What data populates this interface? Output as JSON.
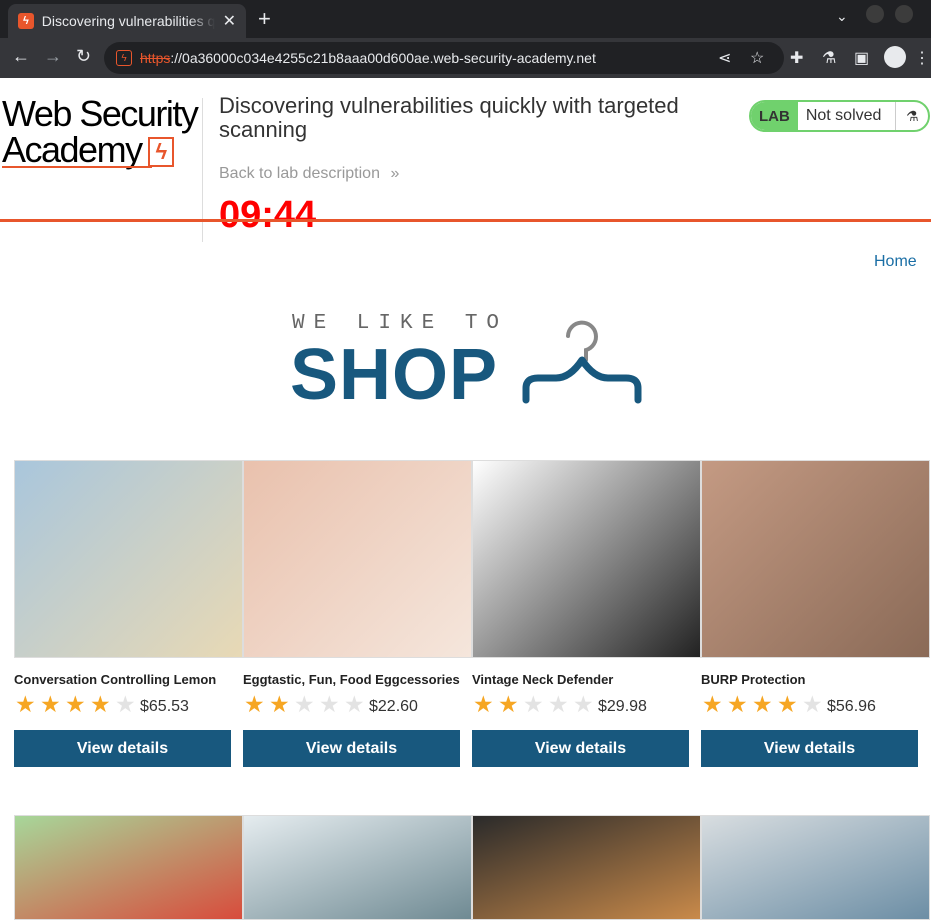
{
  "browser": {
    "tab_title": "Discovering vulnerabilities quickly with targeted scanning",
    "url_scheme": "https",
    "url_host": "://0a36000c034e4255c21b8aaa00d600ae.web-security-academy.net"
  },
  "academy": {
    "logo_line1": "Web Security",
    "logo_line2": "Academy",
    "lab_title": "Discovering vulnerabilities quickly with targeted scanning",
    "back_link": "Back to lab description",
    "back_chevron": "»",
    "timer": "09:44",
    "status_badge": "LAB",
    "status_text": "Not solved"
  },
  "nav": {
    "home": "Home"
  },
  "banner": {
    "subtitle": "WE LIKE TO",
    "title": "SHOP"
  },
  "products": [
    {
      "name": "Conversation Controlling Lemon",
      "rating": 4,
      "price": "$65.53",
      "button": "View details",
      "palette": [
        "#a9c6dc",
        "#e8d9b5"
      ]
    },
    {
      "name": "Eggtastic, Fun, Food Eggcessories",
      "rating": 2,
      "price": "$22.60",
      "button": "View details",
      "palette": [
        "#e9c1ad",
        "#f5e6dc"
      ]
    },
    {
      "name": "Vintage Neck Defender",
      "rating": 2,
      "price": "$29.98",
      "button": "View details",
      "palette": [
        "#ffffff",
        "#222222"
      ]
    },
    {
      "name": "BURP Protection",
      "rating": 4,
      "price": "$56.96",
      "button": "View details",
      "palette": [
        "#c49a83",
        "#8a6a57"
      ]
    }
  ],
  "second_row_palettes": [
    [
      "#a7d79a",
      "#d84c3c"
    ],
    [
      "#e5ecef",
      "#6f8a93"
    ],
    [
      "#2a2a2a",
      "#c98a4a"
    ],
    [
      "#d8dde0",
      "#6c8ea5"
    ]
  ],
  "colors": {
    "accent_orange": "#e8562c",
    "button_blue": "#18587e",
    "timer_red": "#ff0000",
    "star_on": "#f6a623",
    "star_off": "#e3e3e3",
    "status_green": "#70d16d"
  }
}
